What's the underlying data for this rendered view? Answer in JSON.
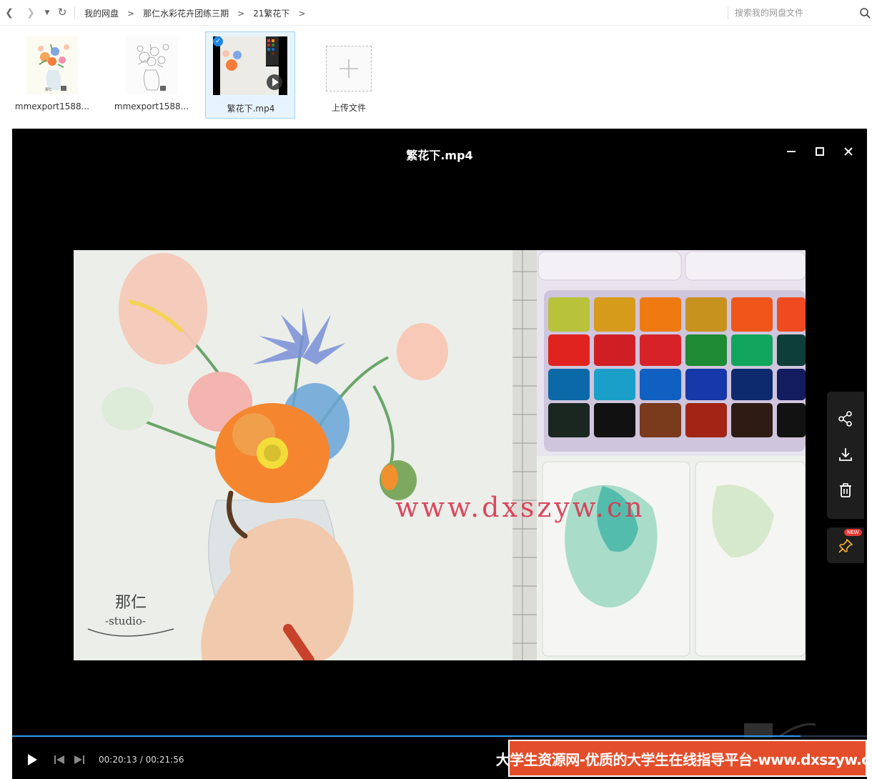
{
  "nav": {
    "breadcrumb": [
      "我的网盘",
      "那仁水彩花卉团练三期",
      "21繁花下"
    ],
    "separator": ">",
    "search_placeholder": "搜索我的网盘文件"
  },
  "files": [
    {
      "name": "mmexport1588...",
      "selected": false
    },
    {
      "name": "mmexport1588...",
      "selected": false
    },
    {
      "name": "繁花下.mp4",
      "selected": true
    },
    {
      "name": "上传文件",
      "selected": false
    }
  ],
  "player": {
    "title": "繁花下.mp4",
    "watermark": "www.dxszyw.cn",
    "video_logo_line1": "那仁",
    "video_logo_line2": "-studio-",
    "time": "00:20:13 / 00:21:56",
    "progress": 0.922,
    "new_badge": "NEW",
    "banner": "大学生资源网-优质的大学生在线指导平台-www.dxszyw.cn"
  },
  "colors": {
    "accent": "#2f9bf0",
    "banner": "#e44d2a",
    "watermark": "#d9364f",
    "selection": "#e8f4fd"
  }
}
